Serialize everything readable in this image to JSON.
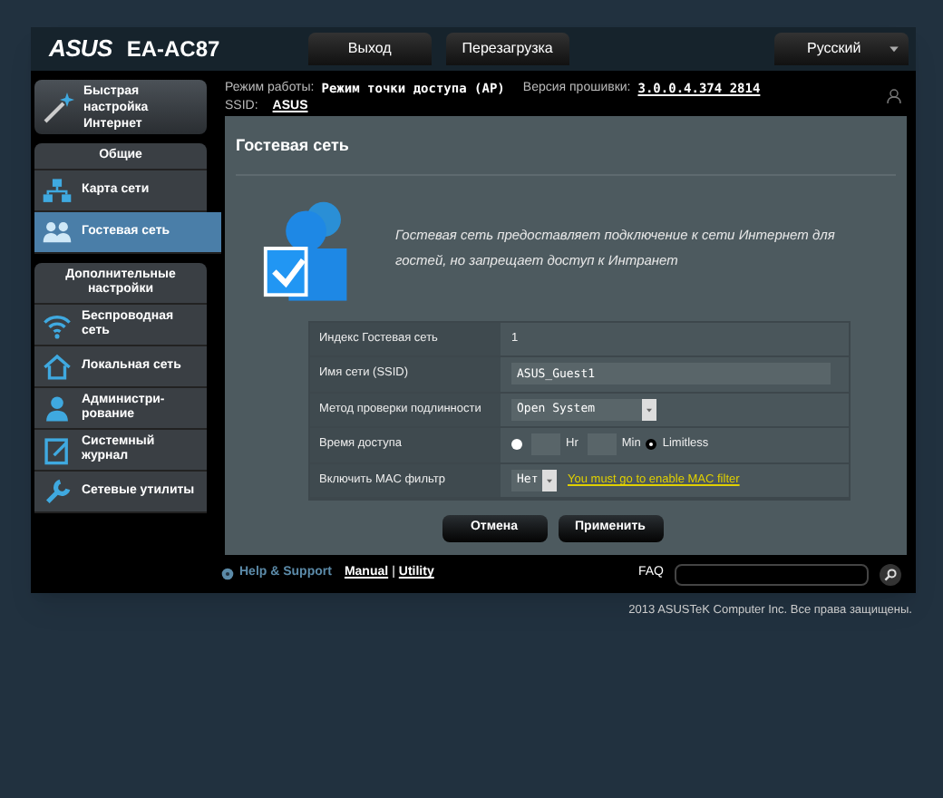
{
  "header": {
    "logo": "ASUS",
    "model": "EA-AC87",
    "buttons": [
      "Выход",
      "Перезагрузка"
    ],
    "language": "Русский"
  },
  "status": {
    "mode_label": "Режим работы:",
    "mode": "Режим точки доступа (AP)",
    "firmware_label": "Версия прошивки:",
    "firmware": "3.0.0.4.374_2814",
    "ssid_label": "SSID:",
    "ssid": "ASUS"
  },
  "sidebar": {
    "quick_setup": "Быстрая настройка Интернет",
    "sections": [
      {
        "title": "Общие",
        "items": [
          {
            "label": "Карта сети",
            "kind": "network",
            "selected": false
          },
          {
            "label": "Гостевая сеть",
            "kind": "guests",
            "selected": true
          }
        ]
      },
      {
        "title": "Дополнительные настройки",
        "items": [
          {
            "label": "Беспроводная сеть",
            "kind": "wifi",
            "selected": false
          },
          {
            "label": "Локальная сеть",
            "kind": "home",
            "selected": false
          },
          {
            "label": "Администри-рование",
            "kind": "admin",
            "selected": false
          },
          {
            "label": "Системный журнал",
            "kind": "log",
            "selected": false
          },
          {
            "label": "Сетевые утилиты",
            "kind": "tools",
            "selected": false
          }
        ]
      }
    ]
  },
  "panel": {
    "title": "Гостевая сеть",
    "description": "Гостевая сеть предоставляет подключение к сети Интернет для гостей, но запрещает доступ к Интранет",
    "rows": [
      {
        "kind": "text",
        "label": "Индекс Гостевая сеть",
        "value": "1"
      },
      {
        "kind": "input",
        "label": "Имя сети (SSID)",
        "value": "ASUS_Guest1"
      },
      {
        "kind": "select",
        "label": "Метод проверки подлинности",
        "value": "Open System"
      },
      {
        "kind": "time",
        "label": "Время доступа",
        "hours_unit": "Hr",
        "minutes_unit": "Min",
        "limited_checked": false,
        "limitless_checked": true,
        "limitless_label": "Limitless"
      },
      {
        "kind": "select_link",
        "label": "Включить MAC фильтр",
        "value": "Нет",
        "link": "You must go to enable MAC filter"
      }
    ],
    "buttons": [
      "Отмена",
      "Применить"
    ]
  },
  "footer": {
    "help": "Help & Support",
    "manual": "Manual",
    "separator": "|",
    "utility": "Utility",
    "faq": "FAQ"
  },
  "copyright": "2013  ASUSTeK Computer Inc. Все права защищены."
}
